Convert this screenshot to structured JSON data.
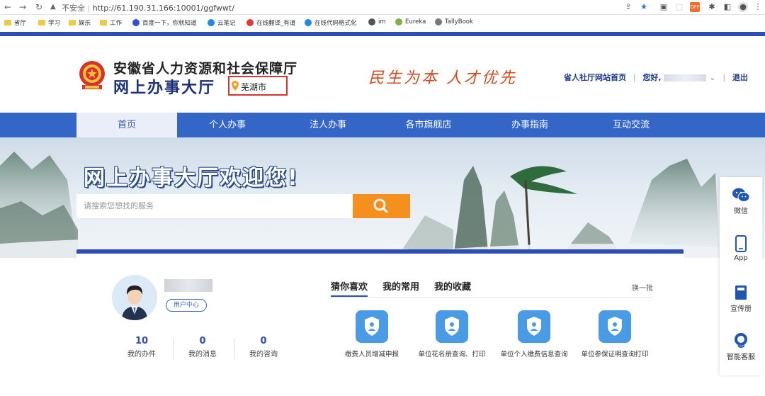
{
  "browser": {
    "security_label": "不安全",
    "url": "http://61.190.31.166:10001/ggfwwt/",
    "bookmarks": [
      {
        "label": "省厅",
        "icon": "folder-icon"
      },
      {
        "label": "学习",
        "icon": "folder-icon"
      },
      {
        "label": "娱乐",
        "icon": "folder-icon"
      },
      {
        "label": "工作",
        "icon": "folder-icon"
      },
      {
        "label": "百度一下，你就知道",
        "icon": "baidu-icon"
      },
      {
        "label": "云笔记",
        "icon": "cloud-note-icon"
      },
      {
        "label": "在线翻译_有道",
        "icon": "youdao-icon"
      },
      {
        "label": "在线代码格式化",
        "icon": "code-format-icon"
      },
      {
        "label": "im",
        "icon": "globe-icon"
      },
      {
        "label": "Eureka",
        "icon": "leaf-icon"
      },
      {
        "label": "TallyBook",
        "icon": "book-icon"
      }
    ]
  },
  "header": {
    "org_name": "安徽省人力资源和社会保障厅",
    "hall_name": "网上办事大厅",
    "city": "芜湖市",
    "slogan": "民生为本  人才优先",
    "links": {
      "home": "省人社厅网站首页",
      "greeting": "您好,",
      "logout": "退出"
    }
  },
  "nav": {
    "items": [
      "首页",
      "个人办事",
      "法人办事",
      "各市旗舰店",
      "办事指南",
      "互动交流"
    ],
    "active_index": 0
  },
  "banner": {
    "welcome": "网上办事大厅欢迎您!",
    "search_placeholder": "请搜索您想找的服务"
  },
  "side_float": {
    "items": [
      {
        "label": "微信",
        "icon": "wechat-icon"
      },
      {
        "label": "App",
        "icon": "phone-icon"
      },
      {
        "label": "宣传册",
        "icon": "brochure-icon"
      },
      {
        "label": "智能客服",
        "icon": "customer-service-icon"
      }
    ]
  },
  "user_panel": {
    "center_button": "用户中心",
    "stats": [
      {
        "value": "10",
        "label": "我的办件"
      },
      {
        "value": "0",
        "label": "我的消息"
      },
      {
        "value": "0",
        "label": "我的咨询"
      }
    ]
  },
  "services": {
    "tabs": [
      "猜你喜欢",
      "我的常用",
      "我的收藏"
    ],
    "refresh": "换一批",
    "items": [
      {
        "label": "缴费人员增减申报"
      },
      {
        "label": "单位花名册查询、打印"
      },
      {
        "label": "单位个人缴费信息查询"
      },
      {
        "label": "单位参保证明查询打印"
      }
    ]
  },
  "colors": {
    "primary_blue": "#3366c6",
    "dark_blue": "#2d4fb5",
    "search_orange": "#f5901e",
    "highlight_red": "#d9342b",
    "slogan_red": "#d04a1c"
  }
}
